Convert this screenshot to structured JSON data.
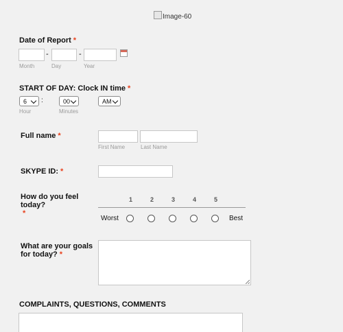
{
  "header_image": {
    "alt": "Image-60"
  },
  "date_of_report": {
    "label": "Date of Report",
    "required": "*",
    "separator": "-",
    "sublabels": {
      "month": "Month",
      "day": "Day",
      "year": "Year"
    },
    "icon": "calendar-icon"
  },
  "clock_in": {
    "label": "START OF DAY: Clock IN time",
    "required": "*",
    "hour": "6",
    "colon": ":",
    "minutes": "00",
    "ampm": "AM",
    "sublabels": {
      "hour": "Hour",
      "minutes": "Minutes"
    }
  },
  "full_name": {
    "label": "Full name",
    "required": "*",
    "sublabels": {
      "first": "First Name",
      "last": "Last Name"
    }
  },
  "skype": {
    "label": "SKYPE ID:",
    "required": "*"
  },
  "feeling": {
    "label": "How do you feel today?",
    "required": "*",
    "scale": [
      "1",
      "2",
      "3",
      "4",
      "5"
    ],
    "low_label": "Worst",
    "high_label": "Best"
  },
  "goals": {
    "label": "What are your goals for today?",
    "required": "*"
  },
  "complaints": {
    "label": "COMPLAINTS, QUESTIONS, COMMENTS"
  },
  "colors": {
    "required": "#e8401c",
    "background": "#f1f1f1"
  }
}
